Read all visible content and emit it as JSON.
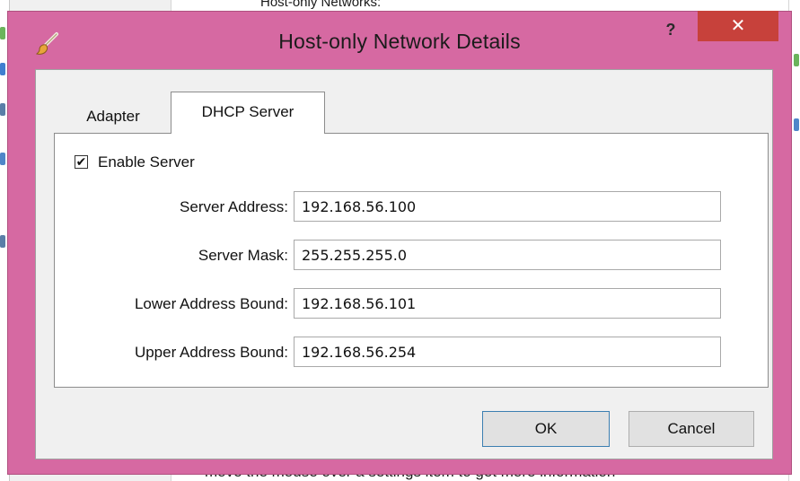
{
  "background": {
    "header_text": "Host-only Networks:",
    "footer_text": "move the mouse over a settings item to get more information"
  },
  "dialog": {
    "title": "Host-only Network Details",
    "help_label": "?",
    "close_label": "✕",
    "icon": "paintbrush-icon",
    "accent_color": "#d669a2",
    "close_color": "#c7413b"
  },
  "tabs": [
    {
      "label": "Adapter",
      "selected": false
    },
    {
      "label": "DHCP Server",
      "selected": true
    }
  ],
  "dhcp": {
    "enable_label": "Enable Server",
    "enable_checked": true,
    "check_mark": "✔",
    "fields": [
      {
        "label": "Server Address:",
        "value": "192.168.56.100"
      },
      {
        "label": "Server Mask:",
        "value": "255.255.255.0"
      },
      {
        "label": "Lower Address Bound:",
        "value": "192.168.56.101"
      },
      {
        "label": "Upper Address Bound:",
        "value": "192.168.56.254"
      }
    ]
  },
  "buttons": {
    "ok_label": "OK",
    "cancel_label": "Cancel"
  }
}
